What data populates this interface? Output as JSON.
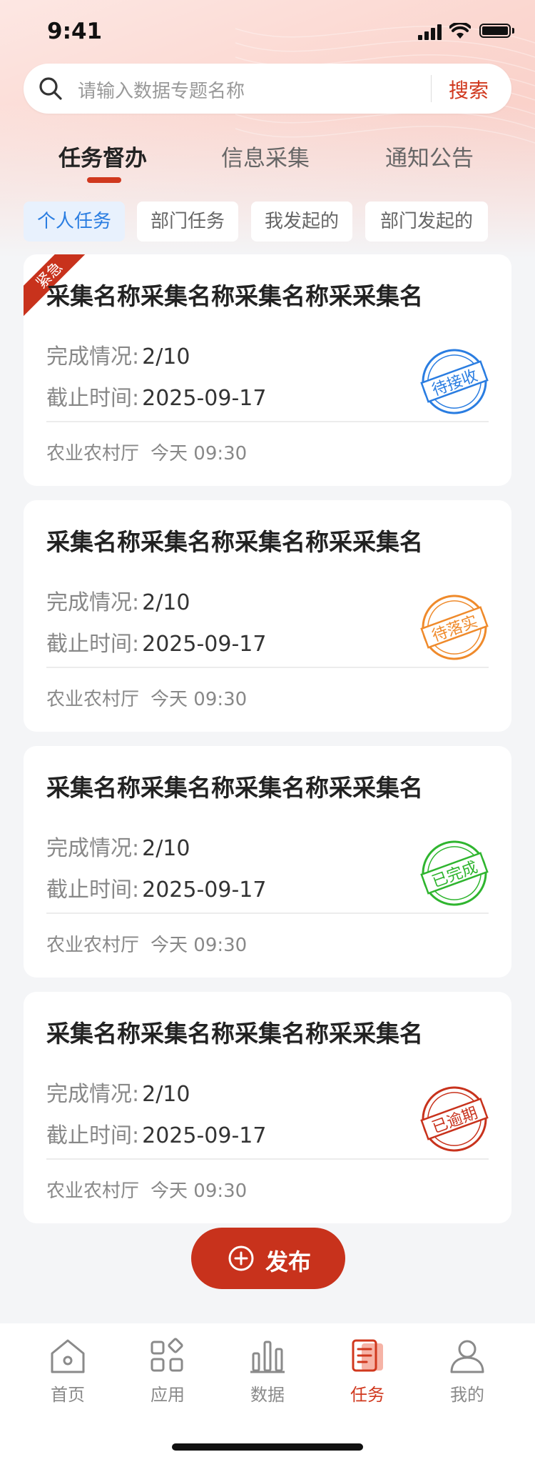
{
  "status_bar": {
    "time": "9:41"
  },
  "search": {
    "placeholder": "请输入数据专题名称",
    "button": "搜索"
  },
  "main_tabs": [
    {
      "label": "任务督办",
      "active": true
    },
    {
      "label": "信息采集",
      "active": false
    },
    {
      "label": "通知公告",
      "active": false
    }
  ],
  "sub_tabs": [
    {
      "label": "个人任务",
      "active": true
    },
    {
      "label": "部门任务",
      "active": false
    },
    {
      "label": "我发起的",
      "active": false
    },
    {
      "label": "部门发起的",
      "active": false
    }
  ],
  "labels": {
    "progress": "完成情况:",
    "deadline": "截止时间:"
  },
  "tasks": [
    {
      "urgent_tag": "紧急",
      "title": "采集名称采集名称采集名称采采集名",
      "progress": "2/10",
      "deadline": "2025-09-17",
      "department": "农业农村厅",
      "time": "今天 09:30",
      "status": "待接收",
      "status_color": "#2a7de1"
    },
    {
      "title": "采集名称采集名称采集名称采采集名",
      "progress": "2/10",
      "deadline": "2025-09-17",
      "department": "农业农村厅",
      "time": "今天 09:30",
      "status": "待落实",
      "status_color": "#ef8a2b"
    },
    {
      "title": "采集名称采集名称采集名称采采集名",
      "progress": "2/10",
      "deadline": "2025-09-17",
      "department": "农业农村厅",
      "time": "今天 09:30",
      "status": "已完成",
      "status_color": "#2fb52f"
    },
    {
      "title": "采集名称采集名称采集名称采采集名",
      "progress": "2/10",
      "deadline": "2025-09-17",
      "department": "农业农村厅",
      "time": "今天 09:30",
      "status": "已逾期",
      "status_color": "#c8321c"
    }
  ],
  "publish_button": "发布",
  "tab_bar": [
    {
      "label": "首页",
      "icon": "home-icon"
    },
    {
      "label": "应用",
      "icon": "apps-icon"
    },
    {
      "label": "数据",
      "icon": "data-chart-icon"
    },
    {
      "label": "任务",
      "icon": "task-icon",
      "active": true
    },
    {
      "label": "我的",
      "icon": "user-icon"
    }
  ],
  "colors": {
    "accent": "#d0381e",
    "chip_active": "#2a7de1"
  }
}
